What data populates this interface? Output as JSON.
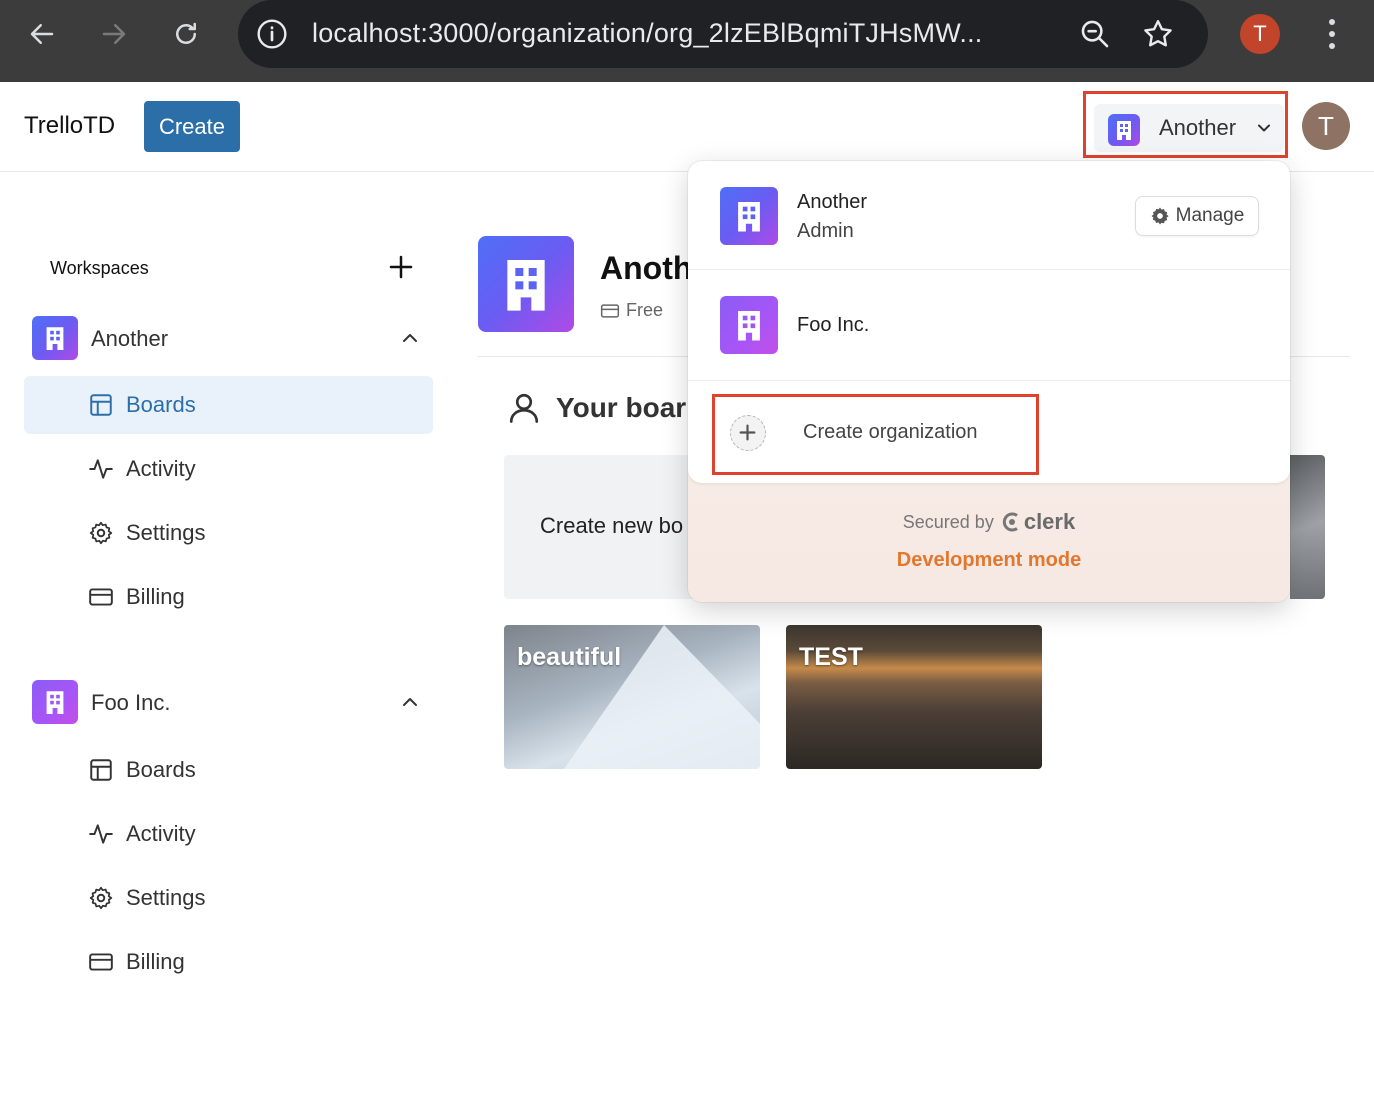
{
  "browser": {
    "url": "localhost:3000/organization/org_2lzEBlBqmiTJHsMW...",
    "profile_initial": "T"
  },
  "header": {
    "brand": "TrelloTD",
    "create_label": "Create",
    "org_switcher_label": "Another",
    "avatar_initial": "T"
  },
  "sidebar": {
    "title": "Workspaces",
    "orgs": [
      {
        "name": "Another",
        "items": [
          {
            "label": "Boards",
            "icon": "boards-icon",
            "active": true
          },
          {
            "label": "Activity",
            "icon": "activity-icon"
          },
          {
            "label": "Settings",
            "icon": "settings-icon"
          },
          {
            "label": "Billing",
            "icon": "billing-icon"
          }
        ]
      },
      {
        "name": "Foo Inc.",
        "items": [
          {
            "label": "Boards",
            "icon": "boards-icon"
          },
          {
            "label": "Activity",
            "icon": "activity-icon"
          },
          {
            "label": "Settings",
            "icon": "settings-icon"
          },
          {
            "label": "Billing",
            "icon": "billing-icon"
          }
        ]
      }
    ]
  },
  "main": {
    "org_name": "Anoth",
    "plan": "Free",
    "section_title": "Your boar",
    "create_board_label": "Create new bo",
    "boards": [
      {
        "title": "beautiful"
      },
      {
        "title": "TEST"
      }
    ]
  },
  "dropdown": {
    "active_org": {
      "name": "Another",
      "role": "Admin",
      "manage_label": "Manage"
    },
    "other_org": {
      "name": "Foo Inc."
    },
    "create_org_label": "Create organization",
    "secured_by": "Secured by",
    "clerk": "clerk",
    "dev_mode": "Development mode"
  },
  "colors": {
    "highlight": "#e0432d",
    "primary": "#2c6ea7",
    "dev_mode": "#e2772f"
  }
}
